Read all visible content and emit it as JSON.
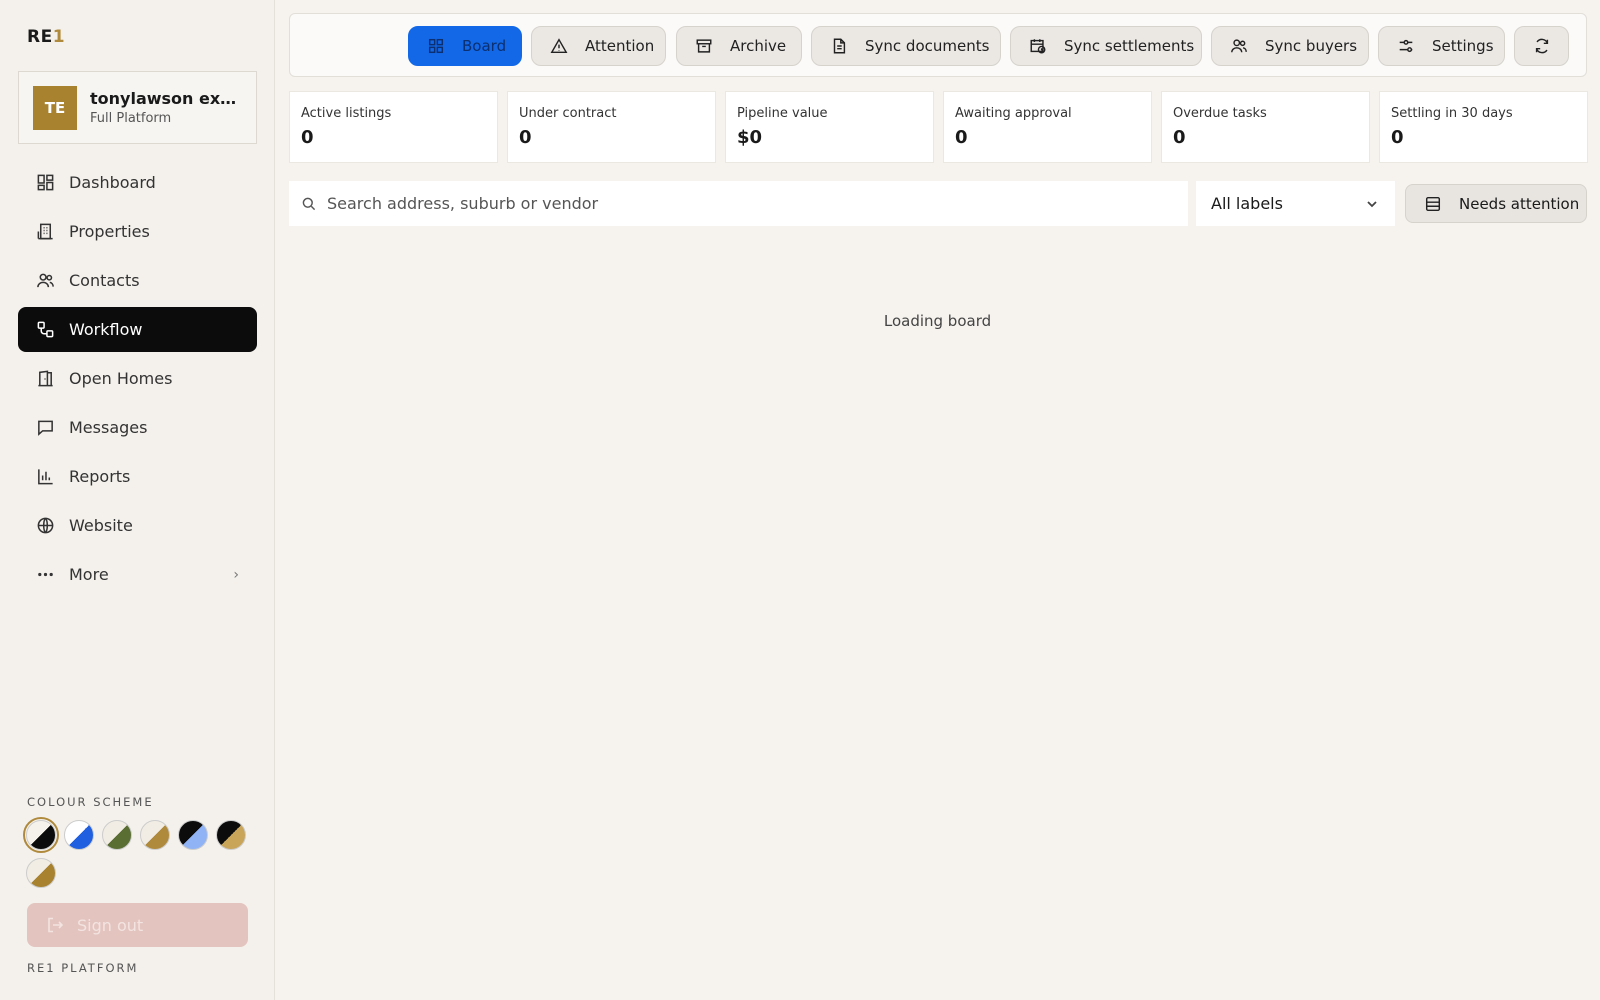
{
  "brand": {
    "logo_main": "RE",
    "logo_accent": "1",
    "accent_color": "#b08a3c"
  },
  "account": {
    "initials": "TE",
    "name": "tonylawson exp &amp; more",
    "plan": "Full Platform"
  },
  "nav": {
    "items": [
      {
        "label": "Dashboard",
        "icon": "dashboard-icon"
      },
      {
        "label": "Properties",
        "icon": "building-icon"
      },
      {
        "label": "Contacts",
        "icon": "users-icon"
      },
      {
        "label": "Workflow",
        "icon": "workflow-icon",
        "active": true
      },
      {
        "label": "Open Homes",
        "icon": "door-icon"
      },
      {
        "label": "Messages",
        "icon": "message-icon"
      },
      {
        "label": "Reports",
        "icon": "bar-chart-icon"
      },
      {
        "label": "Website",
        "icon": "globe-icon"
      },
      {
        "label": "More",
        "icon": "more-icon"
      }
    ]
  },
  "colour_scheme": {
    "label": "COLOUR SCHEME",
    "swatches": [
      {
        "a": "#f5f2ec",
        "b": "#0c0c0c",
        "selected": true
      },
      {
        "a": "#ffffff",
        "b": "#1f5fe0"
      },
      {
        "a": "#f1ede4",
        "b": "#5a6e33"
      },
      {
        "a": "#f1ede4",
        "b": "#b08a3c"
      },
      {
        "a": "#0c0c0c",
        "b": "#8fb3f5"
      },
      {
        "a": "#0c0c0c",
        "b": "#c9a55a"
      },
      {
        "a": "#f1ede4",
        "b": "#a8822f"
      }
    ]
  },
  "sign_out": "Sign out",
  "footer": "RE1 PLATFORM",
  "toolbar": {
    "board": "Board",
    "attention": "Attention",
    "archive": "Archive",
    "sync_documents": "Sync documents",
    "sync_settlements": "Sync settlements",
    "sync_buyers": "Sync buyers",
    "settings": "Settings"
  },
  "stats": [
    {
      "label": "Active listings",
      "value": "0"
    },
    {
      "label": "Under contract",
      "value": "0"
    },
    {
      "label": "Pipeline value",
      "value": "$0"
    },
    {
      "label": "Awaiting approval",
      "value": "0"
    },
    {
      "label": "Overdue tasks",
      "value": "0"
    },
    {
      "label": "Settling in 30 days",
      "value": "0"
    }
  ],
  "search": {
    "placeholder": "Search address, suburb or vendor",
    "value": ""
  },
  "filter": {
    "selected": "All labels"
  },
  "needs_attention": "Needs attention",
  "loading": "Loading board"
}
